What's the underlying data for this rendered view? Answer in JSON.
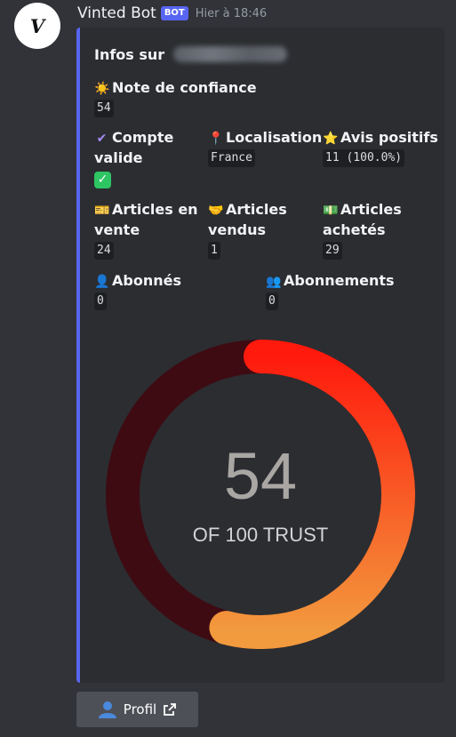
{
  "message": {
    "avatar_letter": "V",
    "username": "Vinted Bot",
    "badge": "BOT",
    "timestamp": "Hier à 18:46"
  },
  "embed": {
    "title": "Infos sur",
    "accent_color": "#5865f2",
    "fields": {
      "note_confiance": {
        "emoji": "sun",
        "name": "Note de confiance",
        "value": "54"
      },
      "compte_valide": {
        "emoji": "heavy-check-mark",
        "name_line1": "Compte",
        "name_line2": "valide",
        "value_emoji": "white-check-mark"
      },
      "localisation": {
        "emoji": "round-pushpin",
        "name": "Localisation",
        "value": "France"
      },
      "avis_positifs": {
        "emoji": "star",
        "name": "Avis positifs",
        "value": "11 (100.0%)"
      },
      "articles_en_vente": {
        "emoji": "ticket",
        "name_line1": "Articles en",
        "name_line2": "vente",
        "value": "24"
      },
      "articles_vendus": {
        "emoji": "handshake",
        "name_line1": "Articles",
        "name_line2": "vendus",
        "value": "1"
      },
      "articles_achetes": {
        "emoji": "dollar-banknote",
        "name_line1": "Articles",
        "name_line2": "achetés",
        "value": "29"
      },
      "abonnes": {
        "emoji": "bust-in-silhouette",
        "name": "Abonnés",
        "value": "0"
      },
      "abonnements": {
        "emoji": "busts-in-silhouette",
        "name": "Abonnements",
        "value": "0"
      }
    },
    "gauge": {
      "score": "54",
      "caption": "OF 100 TRUST",
      "fraction": 0.54,
      "track_color": "#3e0b12",
      "gradient_start": "#ff1a0d",
      "gradient_end": "#f29a3e"
    }
  },
  "button": {
    "label": "Profil",
    "icon": "bust-in-silhouette",
    "external_icon": "external-link-icon"
  }
}
